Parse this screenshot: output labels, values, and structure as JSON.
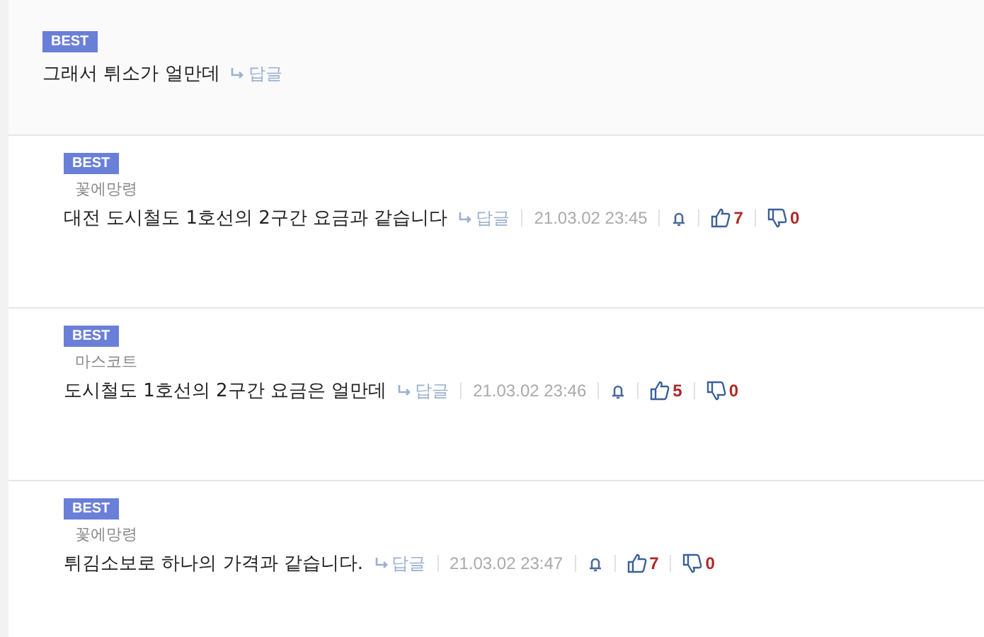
{
  "comments": [
    {
      "kind": "parent",
      "badge": "BEST",
      "text": "그래서 튀소가 얼만데",
      "reply_label": "답글"
    },
    {
      "kind": "reply",
      "badge": "BEST",
      "author": "꽃에망령",
      "text": "대전 도시철도 1호선의 2구간 요금과 같습니다",
      "reply_label": "답글",
      "date": "21.03.02 23:45",
      "likes": "7",
      "dislikes": "0"
    },
    {
      "kind": "reply",
      "badge": "BEST",
      "author": "마스코트",
      "text": "도시철도 1호선의 2구간 요금은 얼만데",
      "reply_label": "답글",
      "date": "21.03.02 23:46",
      "likes": "5",
      "dislikes": "0"
    },
    {
      "kind": "reply",
      "badge": "BEST",
      "author": "꽃에망령",
      "text": "튀김소보로 하나의 가격과 같습니다.",
      "reply_label": "답글",
      "date": "21.03.02 23:47",
      "likes": "7",
      "dislikes": "0"
    }
  ]
}
